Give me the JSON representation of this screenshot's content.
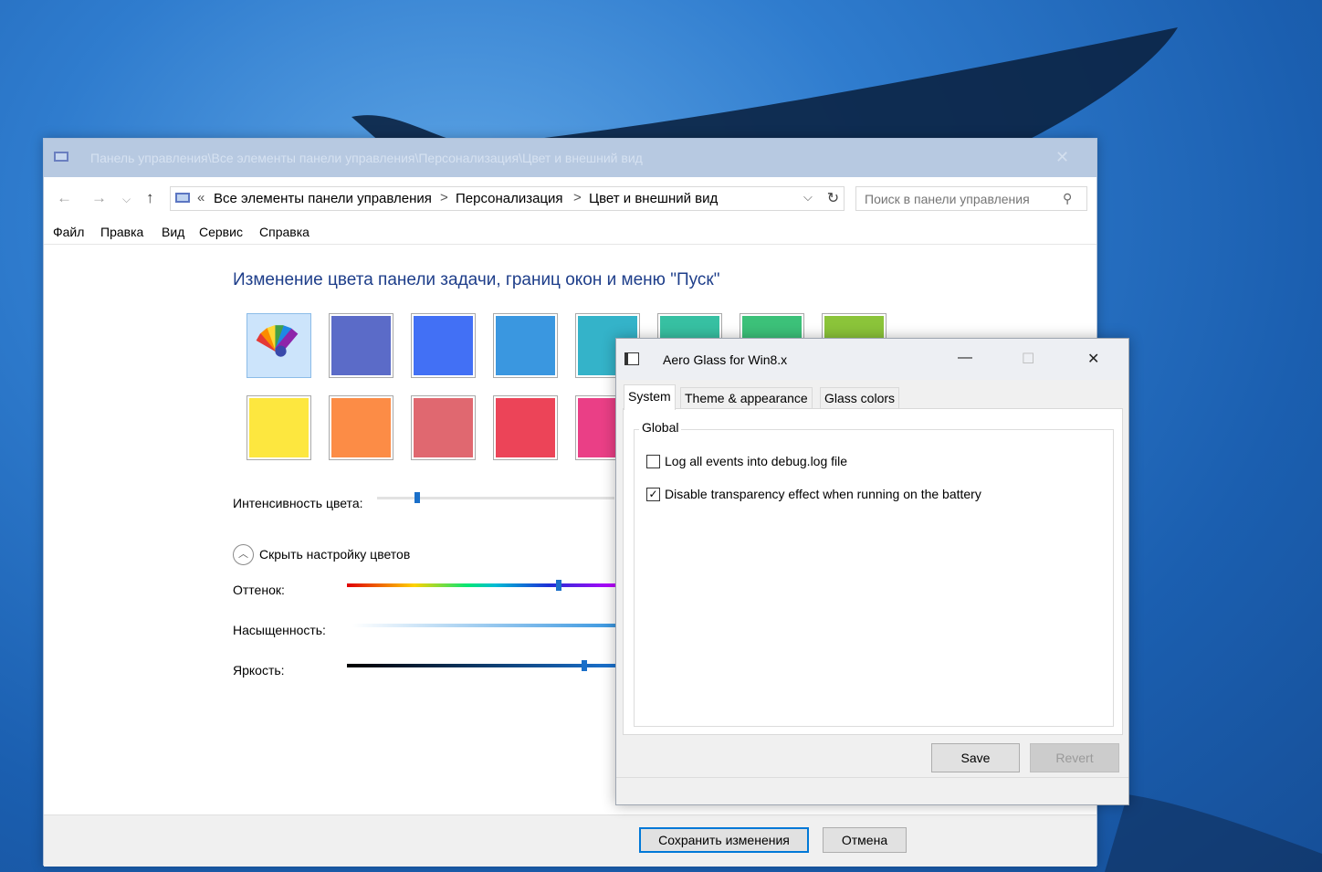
{
  "control_panel": {
    "title": "Панель управления\\Все элементы панели управления\\Персонализация\\Цвет и внешний вид",
    "breadcrumb_prefix": "«",
    "breadcrumbs": [
      "Все элементы панели управления",
      "Персонализация",
      "Цвет и внешний вид"
    ],
    "breadcrumb_separator": ">",
    "search_placeholder": "Поиск в панели управления",
    "menu": [
      "Файл",
      "Правка",
      "Вид",
      "Сервис",
      "Справка"
    ],
    "heading": "Изменение цвета панели задачи, границ окон и меню \"Пуск\"",
    "swatches": [
      {
        "color": "",
        "selected": true,
        "icon": "color-palette-icon"
      },
      {
        "color": "#5b6bc8"
      },
      {
        "color": "#4270f5"
      },
      {
        "color": "#3a97e0"
      },
      {
        "color": "#34b3c9"
      },
      {
        "color": "#37c0a2"
      },
      {
        "color": "#3cc179"
      },
      {
        "color": "#8bc43a"
      },
      {
        "color": "#fde73f"
      },
      {
        "color": "#fc8c46"
      },
      {
        "color": "#e06870"
      },
      {
        "color": "#ec4458"
      },
      {
        "color": "#ea3f86"
      }
    ],
    "intensity_label": "Интенсивность цвета:",
    "intensity_value": 0.17,
    "hide_color_mixer": "Скрыть настройку цветов",
    "hue_label": "Оттенок:",
    "hue_value": 0.58,
    "saturation_label": "Насыщенность:",
    "brightness_label": "Яркость:",
    "brightness_value": 0.65,
    "save_button": "Сохранить изменения",
    "cancel_button": "Отмена"
  },
  "aero_glass": {
    "title": "Aero Glass for Win8.x",
    "tabs": [
      "System",
      "Theme & appearance",
      "Glass colors"
    ],
    "active_tab": "System",
    "group_label": "Global",
    "options": [
      {
        "label": "Log all events into debug.log file",
        "checked": false
      },
      {
        "label": "Disable transparency effect when running on the battery",
        "checked": true
      }
    ],
    "save_button": "Save",
    "revert_button": "Revert"
  },
  "colors": {
    "heading": "#1e3e8a",
    "accent": "#0078d7"
  }
}
